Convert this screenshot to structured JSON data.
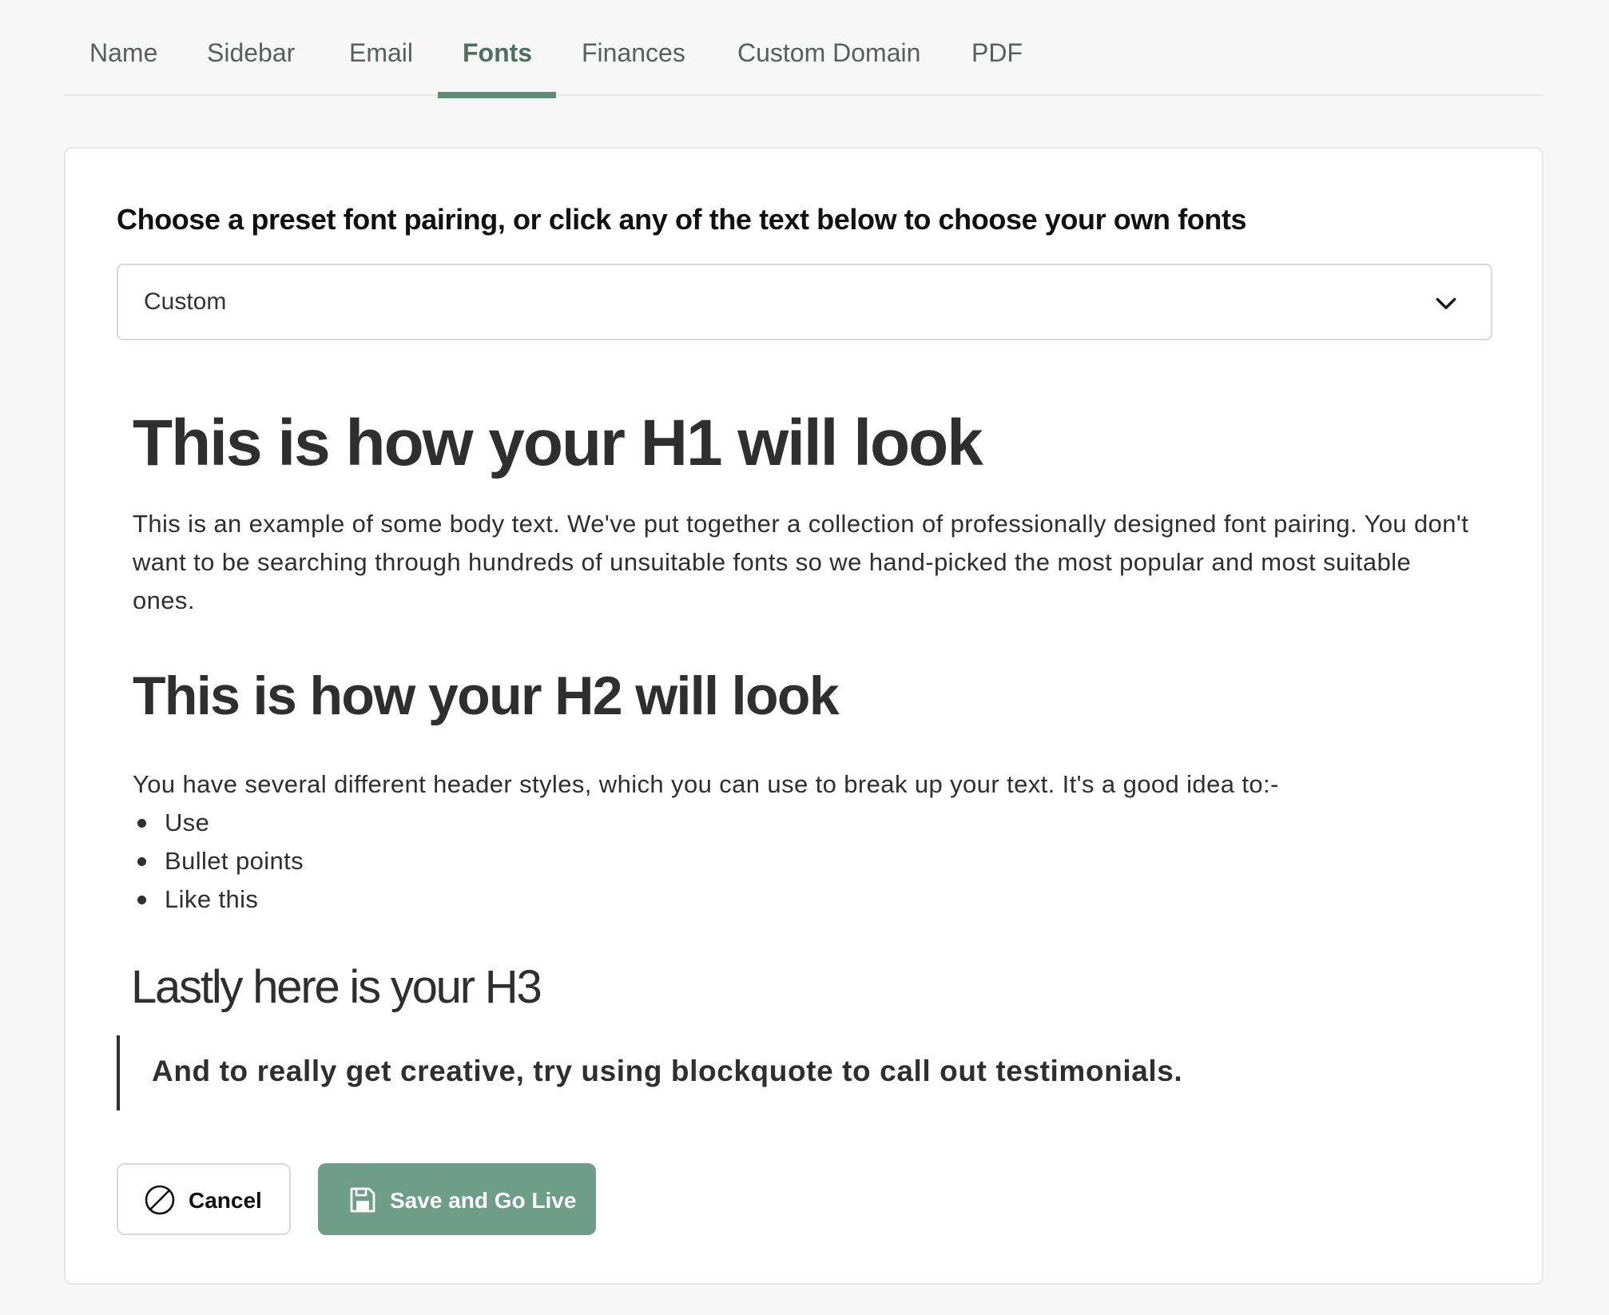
{
  "tabs": [
    {
      "label": "Name",
      "active": false
    },
    {
      "label": "Sidebar",
      "active": false
    },
    {
      "label": "Email",
      "active": false
    },
    {
      "label": "Fonts",
      "active": true
    },
    {
      "label": "Finances",
      "active": false
    },
    {
      "label": "Custom Domain",
      "active": false
    },
    {
      "label": "PDF",
      "active": false
    }
  ],
  "fonts": {
    "intro": "Choose a preset font pairing, or click any of the text below to choose your own fonts",
    "preset_select": {
      "selected": "Custom",
      "icon": "chevron-down-icon"
    },
    "preview": {
      "h1": "This is how your H1 will look",
      "body": "This is an example of some body text. We've put together a collection of professionally designed font pairing. You don't want to be searching through hundreds of unsuitable fonts so we hand-picked the most popular and most suitable ones.",
      "h2": "This is how your H2 will look",
      "paragraph": "You have several different header styles, which you can use to break up your text. It's a good idea to:-",
      "bullets": [
        "Use",
        "Bullet points",
        "Like this"
      ],
      "h3": "Lastly here is your H3",
      "blockquote": "And to really get creative, try using blockquote to call out testimonials."
    }
  },
  "actions": {
    "cancel_label": "Cancel",
    "cancel_icon": "ban-icon",
    "save_label": "Save and Go Live",
    "save_icon": "floppy-disk-icon"
  },
  "colors": {
    "accent": "#5e8c7a",
    "save_button": "#6e9e89",
    "page_background": "#f7f7f7",
    "card_background": "#ffffff"
  }
}
